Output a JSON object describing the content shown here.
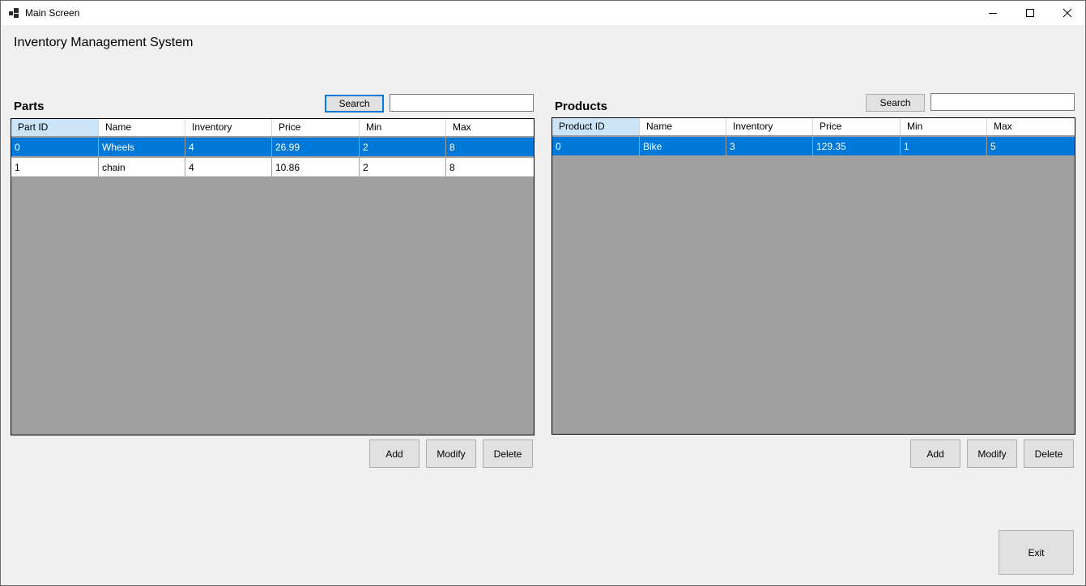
{
  "window": {
    "title": "Main Screen"
  },
  "app_title": "Inventory Management System",
  "parts": {
    "label": "Parts",
    "search_label": "Search",
    "search_value": "",
    "columns": [
      "Part ID",
      "Name",
      "Inventory",
      "Price",
      "Min",
      "Max"
    ],
    "rows": [
      [
        "0",
        "Wheels",
        "4",
        "26.99",
        "2",
        "8"
      ],
      [
        "1",
        "chain",
        "4",
        "10.86",
        "2",
        "8"
      ]
    ],
    "selected_row": 0,
    "add_label": "Add",
    "modify_label": "Modify",
    "delete_label": "Delete"
  },
  "products": {
    "label": "Products",
    "search_label": "Search",
    "search_value": "",
    "columns": [
      "Product ID",
      "Name",
      "Inventory",
      "Price",
      "Min",
      "Max"
    ],
    "rows": [
      [
        "0",
        "Bike",
        "3",
        "129.35",
        "1",
        "5"
      ]
    ],
    "selected_row": 0,
    "add_label": "Add",
    "modify_label": "Modify",
    "delete_label": "Delete"
  },
  "exit_label": "Exit",
  "colors": {
    "selection": "#0078d7",
    "grid_background": "#a0a0a0",
    "header_active": "#cce4f7",
    "focus_border": "#0078d7"
  }
}
